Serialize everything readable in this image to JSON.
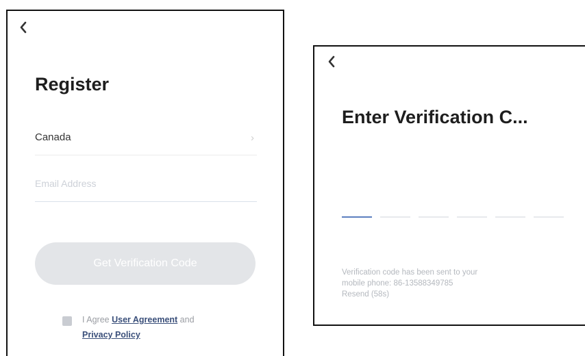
{
  "register": {
    "title": "Register",
    "country": "Canada",
    "email_placeholder": "Email Address",
    "get_code_label": "Get Verification Code",
    "agree_prefix": "I Agree ",
    "user_agreement": "User Agreement",
    "agree_and": " and ",
    "privacy_policy": "Privacy Policy",
    "icons": {
      "back": "chevron-left-icon",
      "country": "chevron-right-icon"
    }
  },
  "verify": {
    "title": "Enter Verification C...",
    "code_slots": 6,
    "info_line1": "Verification code has been sent to your",
    "info_line2": "mobile phone: 86-13588349785",
    "resend": "Resend (58s)",
    "icons": {
      "back": "chevron-left-icon"
    }
  },
  "colors": {
    "accent": "#5b7fbf",
    "button_disabled": "#e3e5e8",
    "link": "#3a4f7a",
    "title": "#1e1e1e"
  }
}
